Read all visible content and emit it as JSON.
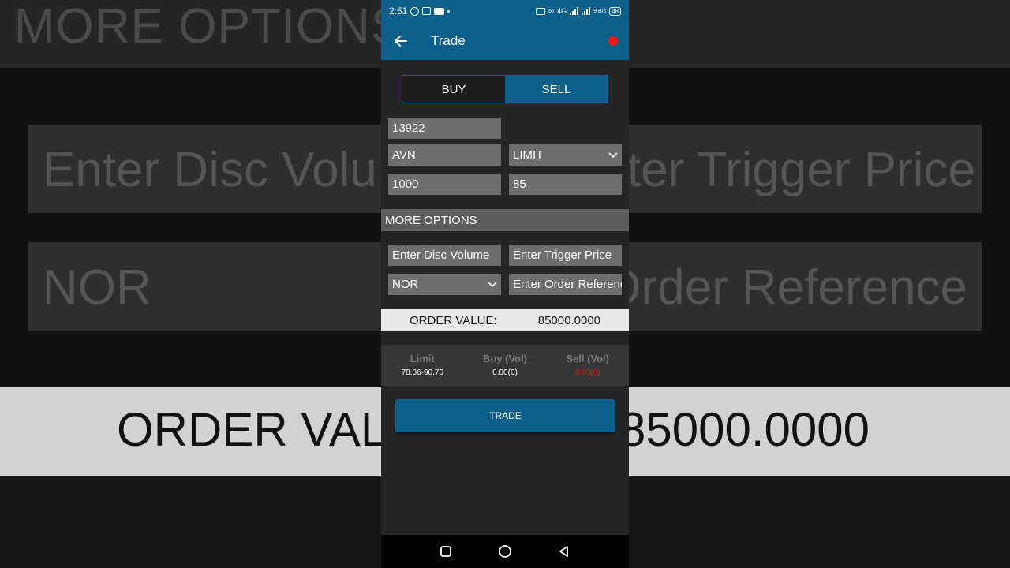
{
  "background": {
    "top_text": "MORE OPTIONS",
    "box1_left_text": "Enter Disc Volume",
    "box1_right_text": "Enter Trigger Price",
    "box2_left_text": "NOR",
    "box2_right_text": "Enter Order Reference",
    "order_label": "ORDER VALUE:",
    "order_value": "85000.0000"
  },
  "status_bar": {
    "time": "2:51",
    "network": "4G",
    "speed": "9 B/s",
    "battery": "48"
  },
  "app_bar": {
    "title": "Trade"
  },
  "toggle": {
    "buy_label": "BUY",
    "sell_label": "SELL",
    "selected": "SELL"
  },
  "form": {
    "account": "13922",
    "symbol": "AVN",
    "order_type": "LIMIT",
    "volume": "1000",
    "price": "85"
  },
  "more_options": {
    "header": "MORE OPTIONS",
    "disc_volume_placeholder": "Enter Disc Volume",
    "trigger_price_placeholder": "Enter Trigger Price",
    "market_type": "NOR",
    "order_reference_placeholder": "Enter Order Reference"
  },
  "order_value": {
    "label": "ORDER VALUE:",
    "value": "85000.0000"
  },
  "limits": {
    "limit_header": "Limit",
    "limit_value": "78.06-90.70",
    "buy_header": "Buy (Vol)",
    "buy_value": "0.00(0)",
    "sell_header": "Sell (Vol)",
    "sell_value": "0.00(0)"
  },
  "trade_button": {
    "label": "TRADE"
  },
  "colors": {
    "primary": "#0b5f8b",
    "record": "#ff1212",
    "sell_volume": "#d91b1b"
  }
}
